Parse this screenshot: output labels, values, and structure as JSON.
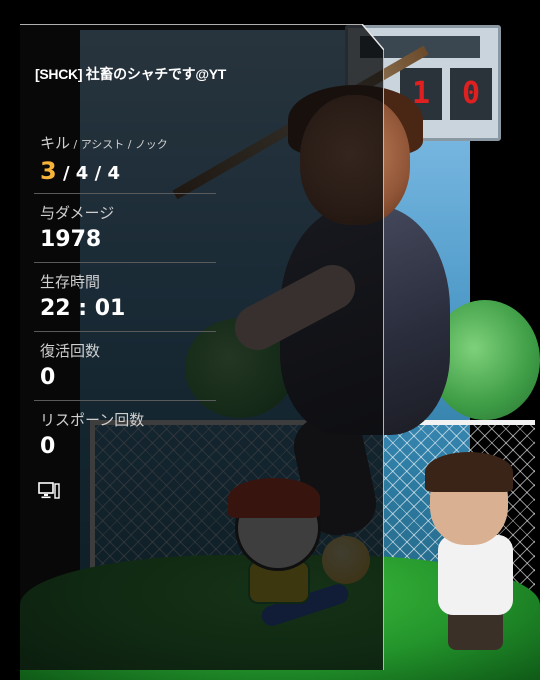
{
  "player_name": "[SHCK] 社畜のシャチです@YT",
  "scoreboard": {
    "left": "1",
    "right": "0"
  },
  "stats": {
    "kills": {
      "label_main": "キル",
      "label_sub": " / アシスト / ノック",
      "kills_value": "3",
      "rest_value": " / 4 / 4"
    },
    "damage": {
      "label": "与ダメージ",
      "value": "1978"
    },
    "survival": {
      "label": "生存時間",
      "value": "22 : 01"
    },
    "revives": {
      "label": "復活回数",
      "value": "0"
    },
    "respawns": {
      "label": "リスポーン回数",
      "value": "0"
    }
  },
  "platform_icon": "pc-monitor-icon",
  "colors": {
    "highlight": "#f5b33a",
    "panel": "#0a0a0c",
    "divider": "#5a5a5a"
  }
}
